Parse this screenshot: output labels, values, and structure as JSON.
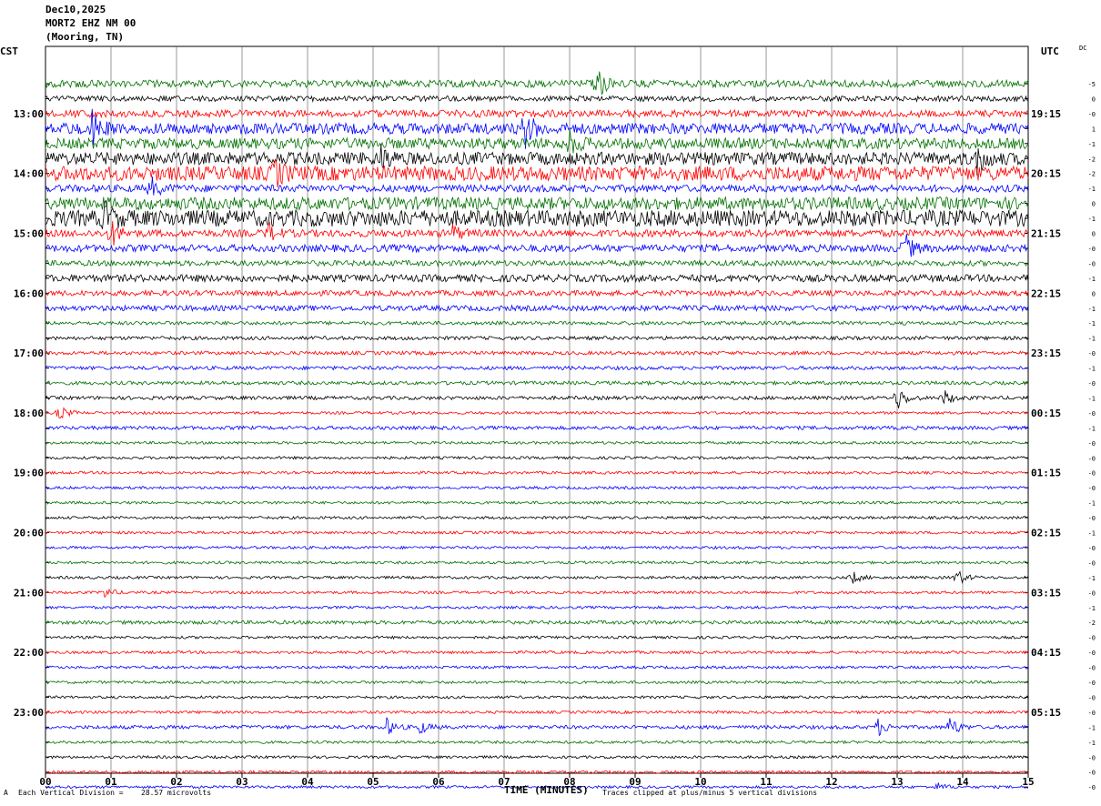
{
  "header": {
    "date": "Dec10,2025",
    "station": "MORT2 EHZ NM 00",
    "location": "(Mooring, TN)"
  },
  "left_tz": "CST",
  "right_tz": "UTC",
  "dc_label": "DC",
  "footer": {
    "scale_prefix": "Each Vertical Division =",
    "scale_value": "28.57 microvolts",
    "clip_note": "Traces clipped at plus/minus 5 vertical divisions",
    "corner_mark": "A"
  },
  "colors": {
    "trace_cycle": [
      "#000000",
      "#ff0000",
      "#0000ff",
      "#007000"
    ],
    "grid": "#000000"
  },
  "chart_data": {
    "type": "line",
    "title": "",
    "xlabel": "TIME (MINUTES)",
    "xlim": [
      0,
      15
    ],
    "x_ticks": [
      "00",
      "01",
      "02",
      "03",
      "04",
      "05",
      "06",
      "07",
      "08",
      "09",
      "10",
      "11",
      "12",
      "13",
      "14",
      "15"
    ],
    "trace_count": 48,
    "traces_per_hour": 4,
    "first_trace_color_index": 3,
    "left_hour_labels": [
      "13:00",
      "14:00",
      "15:00",
      "16:00",
      "17:00",
      "18:00",
      "19:00",
      "20:00",
      "21:00",
      "22:00",
      "23:00"
    ],
    "right_hour_labels": [
      "19:15",
      "20:15",
      "21:15",
      "22:15",
      "23:15",
      "00:15",
      "01:15",
      "02:15",
      "03:15",
      "04:15",
      "05:15"
    ],
    "trace_offsets": [
      "-5",
      "0",
      "-0",
      "1",
      "-1",
      "-2",
      "-2",
      "-1",
      "0",
      "-1",
      "0",
      "-0",
      "-0",
      "-1",
      "0",
      "-1",
      "-1",
      "-1",
      "-0",
      "-1",
      "-0",
      "-1",
      "-0",
      "-1",
      "-0",
      "-0",
      "-0",
      "-0",
      "-1",
      "-0",
      "-1",
      "-0",
      "-0",
      "-1",
      "-0",
      "-1",
      "-2",
      "-0",
      "-0",
      "-0",
      "-0",
      "-0",
      "-0",
      "-1",
      "-1",
      "-0",
      "-0",
      "-0"
    ],
    "noise_levels": [
      4,
      3,
      4,
      6,
      6,
      7,
      8,
      4,
      7,
      9,
      4,
      4,
      3,
      4,
      3,
      3,
      2,
      2,
      2,
      2,
      2,
      2,
      1.5,
      2,
      1.5,
      1.5,
      1.5,
      1.5,
      1.5,
      1.5,
      1.5,
      1.5,
      1.5,
      1.5,
      1.5,
      1.5,
      2,
      1.5,
      1.5,
      1.5,
      1.5,
      1.5,
      1.5,
      2,
      1.5,
      1.5,
      1.5,
      1.5
    ],
    "events": [
      {
        "trace": 0,
        "minute": 8.4,
        "amplitude": 20
      },
      {
        "trace": 3,
        "minute": 0.7,
        "amplitude": 18
      },
      {
        "trace": 3,
        "minute": 7.3,
        "amplitude": 22
      },
      {
        "trace": 4,
        "minute": 8.0,
        "amplitude": 12
      },
      {
        "trace": 5,
        "minute": 5.1,
        "amplitude": 14
      },
      {
        "trace": 5,
        "minute": 14.2,
        "amplitude": 16
      },
      {
        "trace": 6,
        "minute": 3.5,
        "amplitude": 14
      },
      {
        "trace": 7,
        "minute": 1.6,
        "amplitude": 12
      },
      {
        "trace": 9,
        "minute": 0.9,
        "amplitude": 14
      },
      {
        "trace": 10,
        "minute": 1.0,
        "amplitude": 14
      },
      {
        "trace": 10,
        "minute": 3.4,
        "amplitude": 10
      },
      {
        "trace": 10,
        "minute": 6.2,
        "amplitude": 10
      },
      {
        "trace": 11,
        "minute": 13.1,
        "amplitude": 18
      },
      {
        "trace": 21,
        "minute": 13.0,
        "amplitude": 14
      },
      {
        "trace": 21,
        "minute": 13.7,
        "amplitude": 10
      },
      {
        "trace": 22,
        "minute": 0.2,
        "amplitude": 9
      },
      {
        "trace": 33,
        "minute": 12.3,
        "amplitude": 8
      },
      {
        "trace": 33,
        "minute": 13.9,
        "amplitude": 10
      },
      {
        "trace": 34,
        "minute": 0.9,
        "amplitude": 6
      },
      {
        "trace": 43,
        "minute": 5.2,
        "amplitude": 10
      },
      {
        "trace": 43,
        "minute": 5.7,
        "amplitude": 8
      },
      {
        "trace": 43,
        "minute": 12.7,
        "amplitude": 10
      },
      {
        "trace": 43,
        "minute": 13.8,
        "amplitude": 12
      },
      {
        "trace": 47,
        "minute": 13.6,
        "amplitude": 5
      }
    ]
  }
}
